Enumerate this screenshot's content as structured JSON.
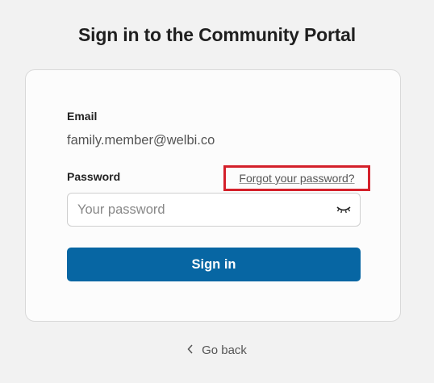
{
  "page": {
    "title": "Sign in to the Community Portal"
  },
  "form": {
    "email_label": "Email",
    "email_value": "family.member@welbi.co",
    "password_label": "Password",
    "forgot_link": "Forgot your password?",
    "password_placeholder": "Your password",
    "password_value": "",
    "visibility_icon": "eye-closed-icon",
    "signin_label": "Sign in"
  },
  "footer": {
    "back_label": "Go back",
    "back_icon": "chevron-left-icon"
  },
  "colors": {
    "primary_button": "#0766a3",
    "highlight_border": "#d4202a"
  }
}
